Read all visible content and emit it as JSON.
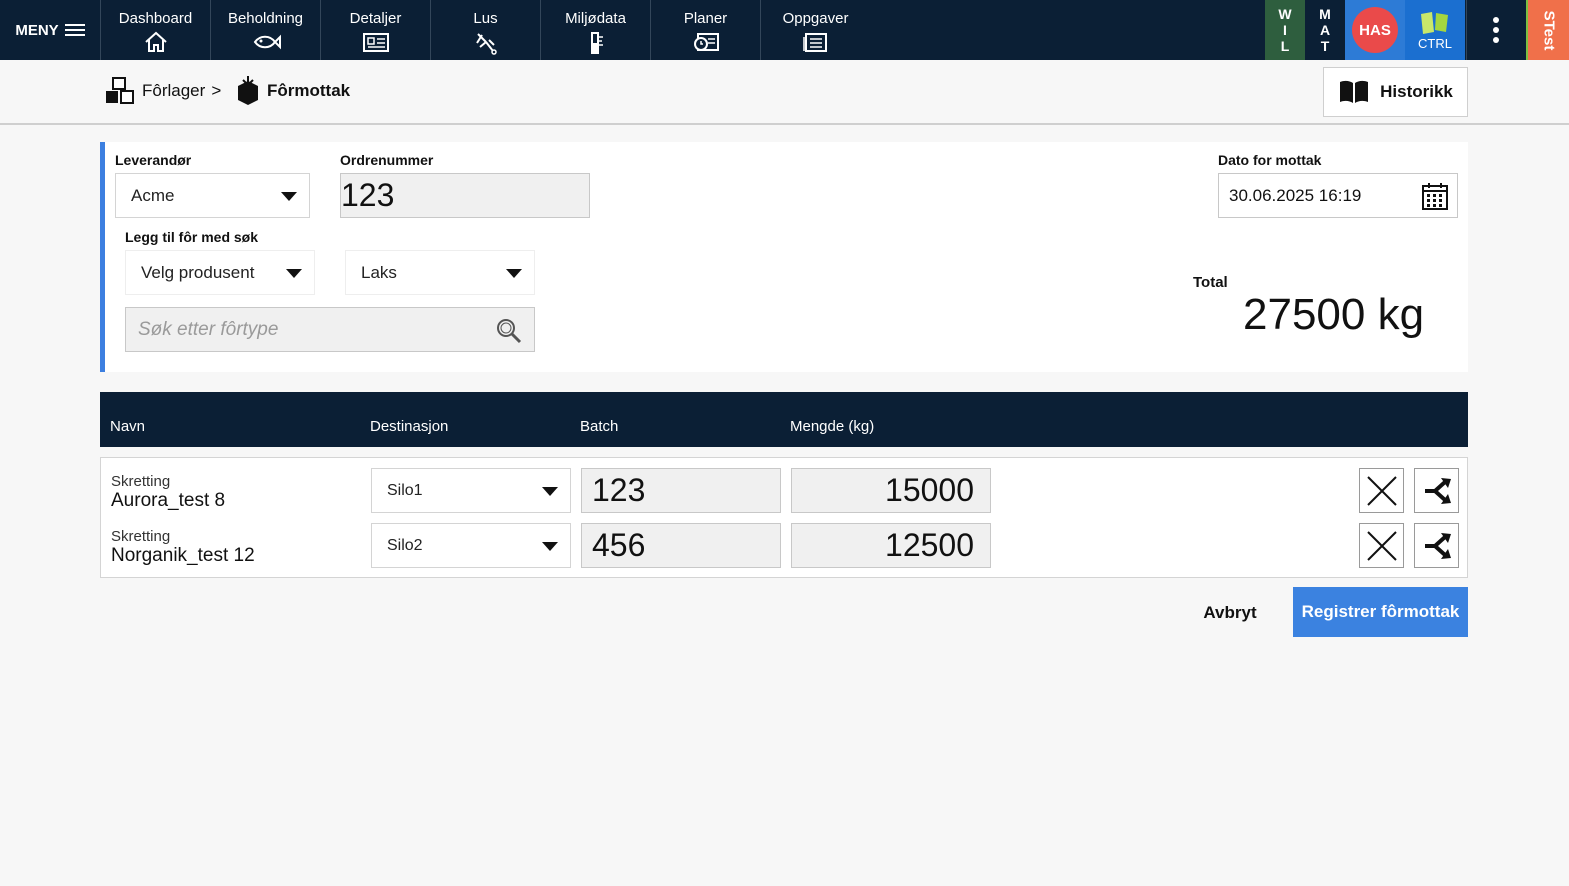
{
  "nav": {
    "menu_label": "MENY",
    "items": [
      {
        "label": "Dashboard",
        "icon": "home-icon"
      },
      {
        "label": "Beholdning",
        "icon": "fish-icon"
      },
      {
        "label": "Detaljer",
        "icon": "details-card-icon"
      },
      {
        "label": "Lus",
        "icon": "lice-icon"
      },
      {
        "label": "Miljødata",
        "icon": "thermometer-icon"
      },
      {
        "label": "Planer",
        "icon": "plans-icon"
      },
      {
        "label": "Oppgaver",
        "icon": "tasks-icon"
      }
    ],
    "right": {
      "wil": [
        "W",
        "I",
        "L"
      ],
      "mat": [
        "M",
        "A",
        "T"
      ],
      "user_initials": "HAS",
      "ctrl_label": "CTRL",
      "env_label": "STest"
    }
  },
  "breadcrumb": {
    "parent": "Fôrlager",
    "separator": ">",
    "current": "Fôrmottak"
  },
  "history_button": "Historikk",
  "form": {
    "supplier_label": "Leverandør",
    "supplier_value": "Acme",
    "order_label": "Ordrenummer",
    "order_value": "123",
    "add_label": "Legg til fôr med søk",
    "producer_select": "Velg produsent",
    "species_select": "Laks",
    "search_placeholder": "Søk etter fôrtype",
    "date_label": "Dato for mottak",
    "date_value": "30.06.2025 16:19",
    "total_label": "Total",
    "total_value": "27500 kg"
  },
  "table": {
    "headers": [
      "Navn",
      "Destinasjon",
      "Batch",
      "Mengde (kg)"
    ],
    "rows": [
      {
        "producer": "Skretting",
        "feed": "Aurora_test 8",
        "destination": "Silo1",
        "batch": "123",
        "amount": "15000"
      },
      {
        "producer": "Skretting",
        "feed": "Norganik_test 12",
        "destination": "Silo2",
        "batch": "456",
        "amount": "12500"
      }
    ]
  },
  "actions": {
    "cancel": "Avbryt",
    "submit": "Registrer fôrmottak"
  },
  "colors": {
    "nav_bg": "#0b1f35",
    "accent": "#3b82e0",
    "user_badge": "#ea4a4a",
    "env_tag": "#f0704a"
  }
}
